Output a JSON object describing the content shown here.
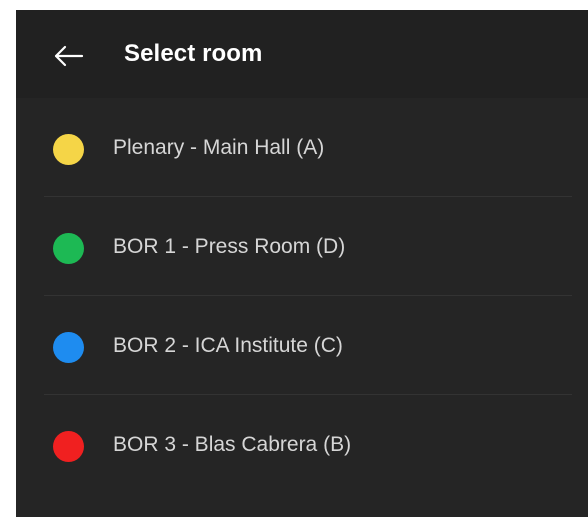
{
  "header": {
    "back_icon": "arrow-left-icon",
    "title": "Select room"
  },
  "rooms": [
    {
      "label": "Plenary - Main Hall (A)",
      "color": "#F5D547"
    },
    {
      "label": "BOR 1 - Press Room (D)",
      "color": "#1DB954"
    },
    {
      "label": "BOR 2 - ICA Institute (C)",
      "color": "#1E8CF0"
    },
    {
      "label": "BOR 3 - Blas Cabrera (B)",
      "color": "#F02020"
    }
  ]
}
